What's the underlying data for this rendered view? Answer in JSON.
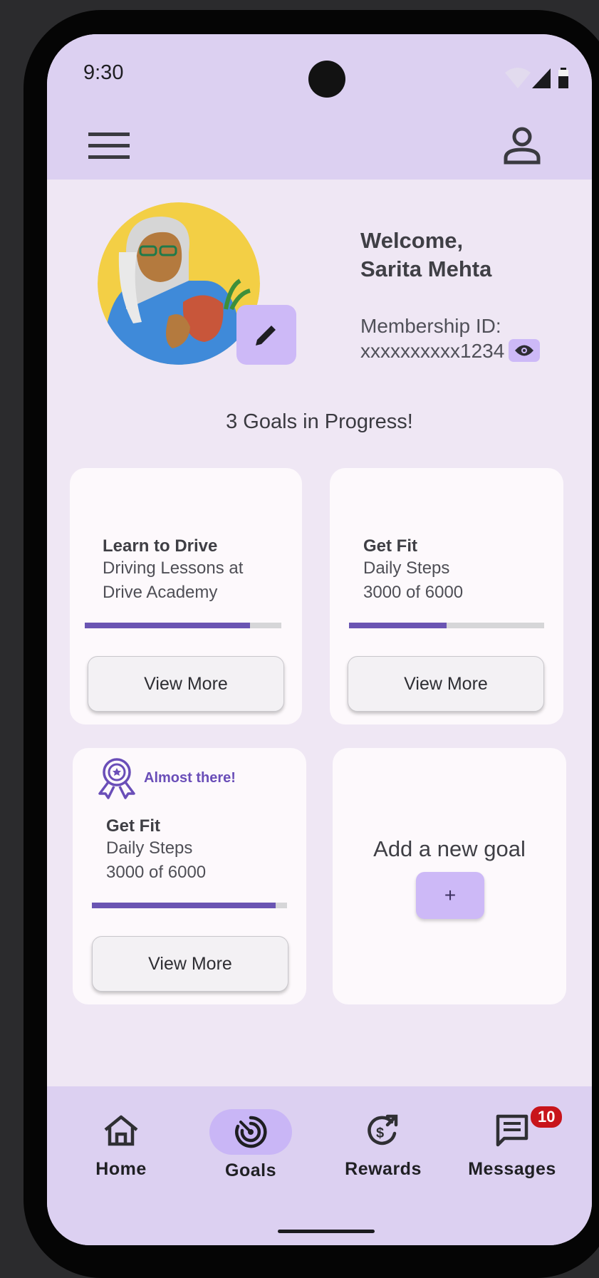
{
  "status_bar": {
    "time": "9:30"
  },
  "profile": {
    "welcome_line1": "Welcome,",
    "welcome_line2": "Sarita Mehta",
    "membership_label": "Membership ID:",
    "membership_id": "xxxxxxxxxx1234"
  },
  "goals": {
    "summary": "3 Goals in Progress!",
    "cards": [
      {
        "title": "Learn to Drive",
        "line1": "Driving Lessons at",
        "line2": "Drive Academy",
        "progress": 0.84,
        "button": "View More"
      },
      {
        "title": "Get Fit",
        "line1": "Daily Steps",
        "line2": "3000 of 6000",
        "progress": 0.5,
        "button": "View More"
      },
      {
        "badge": "Almost there!",
        "title": "Get Fit",
        "line1": "Daily Steps",
        "line2": "3000 of 6000",
        "progress": 0.94,
        "button": "View More"
      }
    ],
    "add_card": {
      "title": "Add a new goal",
      "button": "+"
    }
  },
  "bottom_nav": {
    "items": [
      {
        "label": "Home",
        "icon": "home-icon"
      },
      {
        "label": "Goals",
        "icon": "target-icon",
        "active": true
      },
      {
        "label": "Rewards",
        "icon": "rewards-icon"
      },
      {
        "label": "Messages",
        "icon": "message-icon",
        "badge": "10"
      }
    ]
  },
  "colors": {
    "accent": "#cdb9f7",
    "progress": "#6a55b3",
    "header_bg": "#dcd0f1",
    "page_bg": "#efe7f4",
    "badge_red": "#c8141b"
  }
}
